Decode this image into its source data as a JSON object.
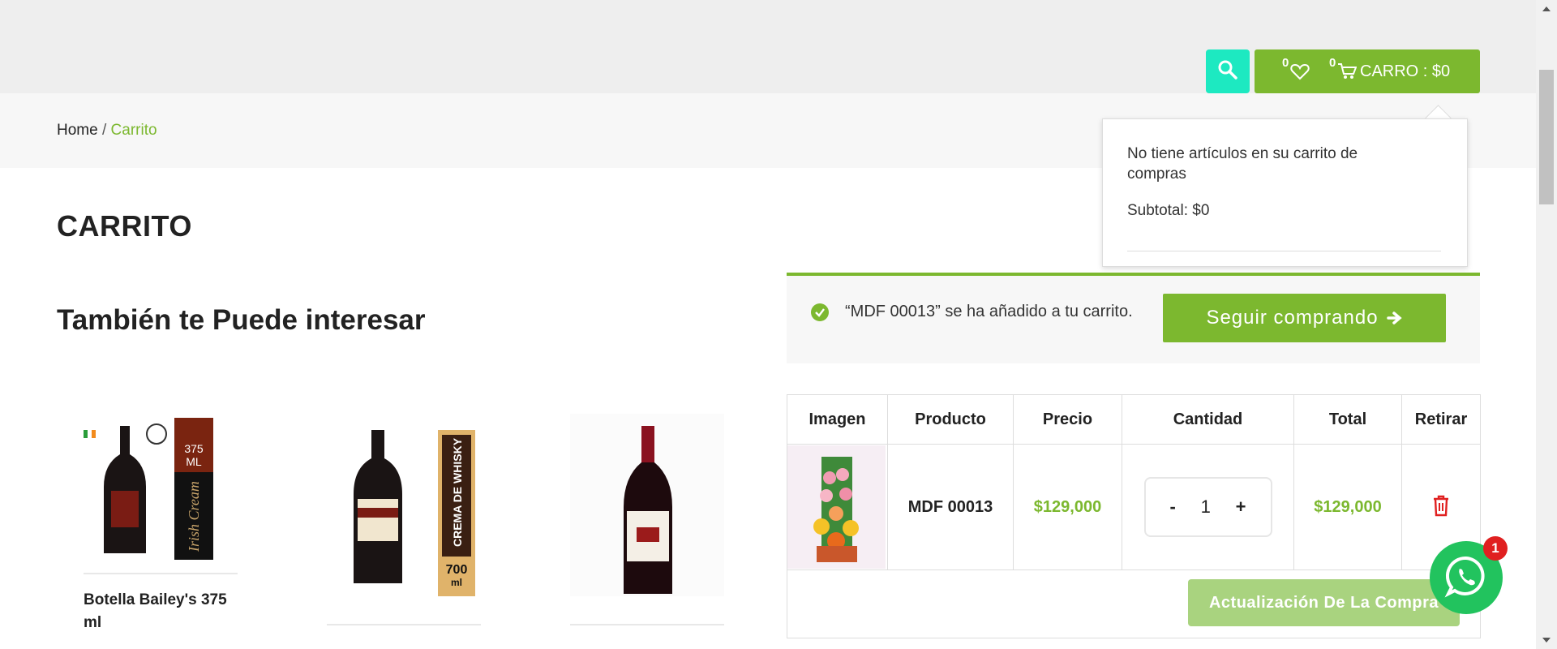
{
  "header": {
    "wishlist_count": "0",
    "cart_count": "0",
    "cart_label": "CARRO : $0",
    "search_icon": "search-icon",
    "heart_icon": "heart-icon",
    "cart_icon": "cart-icon"
  },
  "breadcrumb": {
    "home": "Home",
    "separator": "/",
    "current": "Carrito"
  },
  "page_title": "CARRITO",
  "related": {
    "title": "También te Puede interesar",
    "products": [
      {
        "name": "Botella Bailey's 375 ml",
        "badge_top": "375",
        "badge_bottom": "ML",
        "side_label": "Irish Cream"
      },
      {
        "name": "",
        "side_label": "CREMA DE WHISKY",
        "volume": "700",
        "volume_unit": "ml"
      },
      {
        "name": ""
      }
    ]
  },
  "cart_dropdown": {
    "empty_message": "No tiene artículos en su carrito de compras",
    "subtotal": "Subtotal: $0"
  },
  "notice": {
    "message": "“MDF 00013” se ha añadido a tu carrito.",
    "continue_label": "Seguir comprando"
  },
  "cart_table": {
    "headers": [
      "Imagen",
      "Producto",
      "Precio",
      "Cantidad",
      "Total",
      "Retirar"
    ],
    "rows": [
      {
        "product": "MDF 00013",
        "price": "$129,000",
        "quantity": "1",
        "total": "$129,000",
        "minus": "-",
        "plus": "+"
      }
    ],
    "update_label": "Actualización De La Compra"
  },
  "whatsapp": {
    "badge": "1"
  },
  "colors": {
    "accent": "#7cb82f",
    "search": "#1de9c1",
    "remove": "#e02020",
    "whatsapp": "#22c35e"
  }
}
